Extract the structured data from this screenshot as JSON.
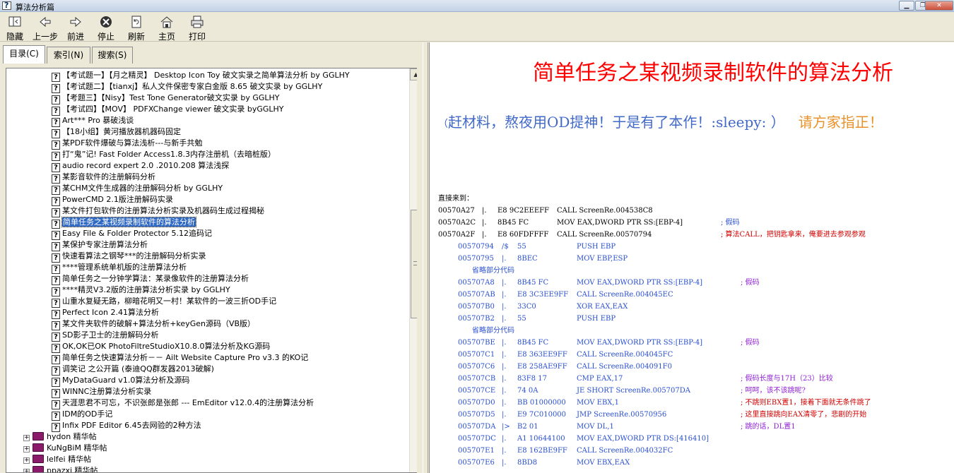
{
  "window": {
    "title": "算法分析篇"
  },
  "toolbar": {
    "hide": "隐藏",
    "back": "上一步",
    "forward": "前进",
    "stop": "停止",
    "refresh": "刷新",
    "home": "主页",
    "print": "打印"
  },
  "tabs": {
    "contents": "目录(C)",
    "index": "索引(N)",
    "search": "搜索(S)"
  },
  "tree": {
    "items": [
      "【考试题一】【月之精灵】 Desktop Icon Toy 破文实录之简单算法分析 by GGLHY",
      "【考试题二】【tianxj】私人文件保密专家白金版 8.65 破文实录 by GGLHY",
      "【考题三】【Nisy】Test Tone Generator破文实录 by GGLHY",
      "【考试四】【MOV】 PDFXChange viewer 破文实录 byGGLHY",
      "Art*** Pro 暴破浅谈",
      "【18小组】黄河播放器机器码固定",
      "某PDF软件爆破与算法浅析---与新手共勉",
      "打“鬼”记! Fast Folder Access1.8.3内存注册机（去暗桩版）",
      "audio record expert 2.0 .2010.208 算法浅探",
      "某影音软件的注册解码分析",
      "某CHM文件生成器的注册解码分析 by GGLHY",
      "PowerCMD 2.1版注册解码实录",
      "某文件打包软件的注册算法分析实录及机器码生成过程揭秘",
      "简单任务之某视频录制软件的算法分析",
      "Easy File & Folder Protector 5.12追码记",
      "某保护专家注册算法分析",
      "快速看算法之钢琴***的注册解码分析实录",
      "****管理系统单机版的注册算法分析",
      "简单任务之一分钟学算法：某录像软件的注册算法分析",
      "****精灵V3.2版的注册算法分析实录 by GGLHY",
      "山重水复疑无路，柳暗花明又一村！某软件的一波三折OD手记",
      "Perfect Icon 2.41算法分析",
      "某文件夹软件的破解+算法分析+keyGen源码（VB版）",
      "SD影子卫士的注册解码分析",
      "OK,OK已OK PhotoFiltreStudioX10.8.0算法分析及KG源码",
      "简单任务之快速算法分析－－ Ailt Website Capture Pro v3.3 的KO记",
      "调笑记 之公开篇 (泰迪QQ群发器2013破解)",
      "MyDataGuard v1.0算法分析及源码",
      "WINNC注册算法分析实录",
      "天涯思君不可忘，不识张郎是张郎 --- EmEditor v12.0.4的注册算法分析",
      "IDM的OD手记",
      "Infix PDF Editor 6.45去网验的2种方法"
    ],
    "books": [
      "hydon 精华帖",
      "KuNgBiM 精华帖",
      "lelfei 精华帖",
      "ppazxj 精华帖"
    ]
  },
  "article": {
    "title": "简单任务之某视频录制软件的算法分析",
    "intro_paren_open": "（",
    "intro_blue": "赶材料，熬夜用OD提神！于是有了本作！:sleepy: ）",
    "intro_orange": "请方家指正！",
    "direct": "直接来到：",
    "lines": [
      {
        "addr": "00570A27",
        "mark": "|.",
        "hex": "E8 9C2EEEFF",
        "asm": "CALL ScreenRe.004538C8",
        "comment": ""
      },
      {
        "addr": "00570A2C",
        "mark": "|.",
        "hex": "8B45 FC",
        "asm": "MOV EAX,DWORD PTR SS:[EBP-4]",
        "comment": ";  假码"
      },
      {
        "addr": "00570A2F",
        "mark": "|.",
        "hex": "E8 60FDFFFF",
        "asm": "CALL ScreenRe.00570794",
        "comment": ";  算法CALL，把钥匙拿来，俺要进去参观参观"
      },
      {
        "addr": "00570794",
        "mark": "/$",
        "hex": "55",
        "asm": "PUSH EBP",
        "comment": ""
      },
      {
        "addr": "00570795",
        "mark": "|.",
        "hex": "8BEC",
        "asm": "MOV EBP,ESP",
        "comment": ""
      },
      {
        "note": "省略部分代码"
      },
      {
        "addr": "005707A8",
        "mark": "|.",
        "hex": "8B45 FC",
        "asm": "MOV EAX,DWORD PTR SS:[EBP-4]",
        "comment": ";  假码"
      },
      {
        "addr": "005707AB",
        "mark": "|.",
        "hex": "E8 3C3EE9FF",
        "asm": "CALL ScreenRe.004045EC",
        "comment": ""
      },
      {
        "addr": "005707B0",
        "mark": "|.",
        "hex": "33C0",
        "asm": "XOR EAX,EAX",
        "comment": ""
      },
      {
        "addr": "005707B2",
        "mark": "|.",
        "hex": "55",
        "asm": "PUSH EBP",
        "comment": ""
      },
      {
        "note": "省略部分代码"
      },
      {
        "addr": "005707BE",
        "mark": "|.",
        "hex": "8B45 FC",
        "asm": "MOV EAX,DWORD PTR SS:[EBP-4]",
        "comment": ";  假码"
      },
      {
        "addr": "005707C1",
        "mark": "|.",
        "hex": "E8 363EE9FF",
        "asm": "CALL ScreenRe.004045FC",
        "comment": ""
      },
      {
        "addr": "005707C6",
        "mark": "|.",
        "hex": "E8 258AE9FF",
        "asm": "CALL ScreenRe.004091F0",
        "comment": ""
      },
      {
        "addr": "005707CB",
        "mark": "|.",
        "hex": "83F8 17",
        "asm": "CMP EAX,17",
        "comment": ";  假码长度与17H（23）比较"
      },
      {
        "addr": "005707CE",
        "mark": "|.",
        "hex": "74 0A",
        "asm": "JE SHORT ScreenRe.005707DA",
        "comment": ";  呵呵，该不该跳呢?"
      },
      {
        "addr": "005707D0",
        "mark": "|.",
        "hex": "BB 01000000",
        "asm": "MOV EBX,1",
        "comment": ";  不跳则EBX置1，接着下面就无条件跳了"
      },
      {
        "addr": "005707D5",
        "mark": "|.",
        "hex": "E9 7C010000",
        "asm": "JMP ScreenRe.00570956",
        "comment": ";  这里直接跳向EAX清零了，悲剧的开始"
      },
      {
        "addr": "005707DA",
        "mark": "|>",
        "hex": "B2 01",
        "asm": "MOV DL,1",
        "comment": ";  跳的话，DL置1"
      },
      {
        "addr": "005707DC",
        "mark": "|.",
        "hex": "A1 10644100",
        "asm": "MOV EAX,DWORD PTR DS:[416410]",
        "comment": ""
      },
      {
        "addr": "005707E1",
        "mark": "|.",
        "hex": "E8 162BE9FF",
        "asm": "CALL ScreenRe.004032FC",
        "comment": ""
      },
      {
        "addr": "005707E6",
        "mark": "|.",
        "hex": "8BD8",
        "asm": "MOV EBX,EAX",
        "comment": ""
      }
    ]
  },
  "colors": {
    "selection": "#316ac5",
    "title_red": "#ff0000",
    "code_blue": "#2a4fd0",
    "comment_red": "#d00000",
    "comment_purple": "#8e1fd6",
    "intro_orange": "#e8922c"
  }
}
